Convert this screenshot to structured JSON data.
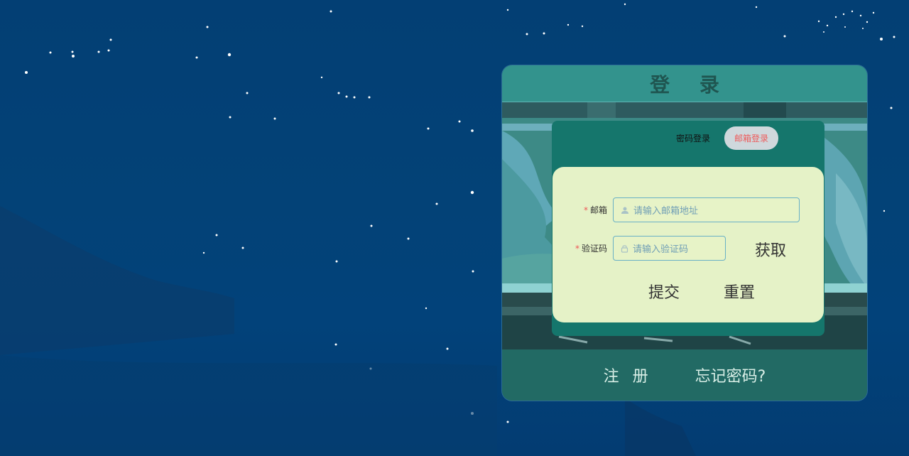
{
  "login_card": {
    "title": "登 录",
    "tabs": [
      {
        "label": "密码登录",
        "active": false
      },
      {
        "label": "邮箱登录",
        "active": true
      }
    ],
    "email_field": {
      "label": "邮箱",
      "placeholder": "请输入邮箱地址",
      "required_mark": "*"
    },
    "code_field": {
      "label": "验证码",
      "placeholder": "请输入验证码",
      "required_mark": "*"
    },
    "get_code_button": "获取",
    "submit_button": "提交",
    "reset_button": "重置",
    "footer": {
      "register": "注 册",
      "forgot": "忘记密码?"
    }
  },
  "colors": {
    "sky": "#033f74",
    "header": "#33938d",
    "panel": "#15766c",
    "form_bg": "#e5f2c7",
    "active_tab_text": "#ee5b5b"
  }
}
